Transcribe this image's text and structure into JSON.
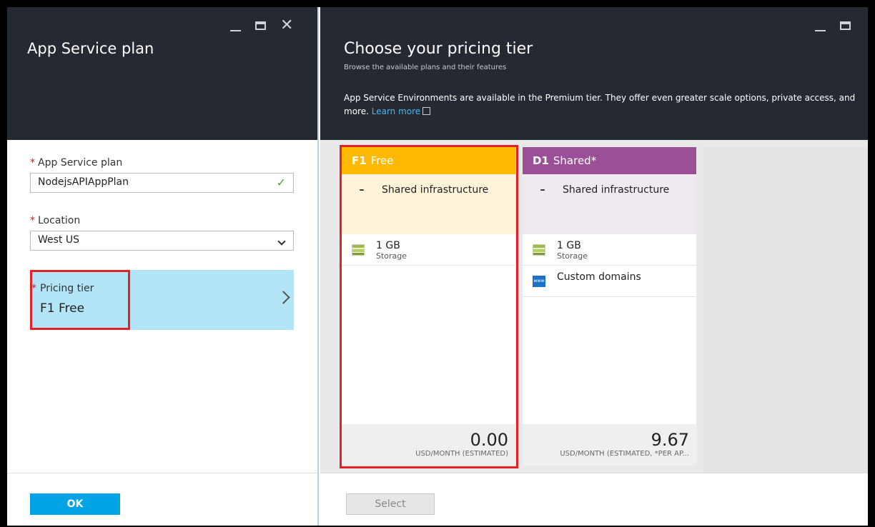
{
  "left_blade": {
    "title": "App Service plan",
    "app_service_plan": {
      "label": "App Service plan",
      "value": "NodejsAPIAppPlan"
    },
    "location": {
      "label": "Location",
      "value": "West US"
    },
    "pricing_tier": {
      "label": "Pricing tier",
      "value": "F1 Free"
    },
    "ok_label": "OK"
  },
  "right_blade": {
    "title": "Choose your pricing tier",
    "subtitle": "Browse the available plans and their features",
    "description": "App Service Environments are available in the Premium tier. They offer even greater scale options, private access, and more.",
    "learn_more": "Learn more",
    "select_label": "Select",
    "tiers": [
      {
        "code": "F1",
        "name": "Free",
        "color": "#ffb900",
        "tint": "#fff4d9",
        "feature": "Shared infrastructure",
        "items": [
          {
            "main": "1 GB",
            "sub": "Storage"
          }
        ],
        "price": "0.00",
        "unit": "USD/MONTH (ESTIMATED)"
      },
      {
        "code": "D1",
        "name": "Shared*",
        "color": "#9b4f96",
        "tint": "#f1e9f0",
        "feature": "Shared infrastructure",
        "items": [
          {
            "main": "1 GB",
            "sub": "Storage"
          },
          {
            "main": "Custom domains"
          }
        ],
        "price": "9.67",
        "unit": "USD/MONTH (ESTIMATED, *PER AP..."
      }
    ]
  },
  "icons": {
    "storage": "storage-icon",
    "domains": "www-icon"
  }
}
